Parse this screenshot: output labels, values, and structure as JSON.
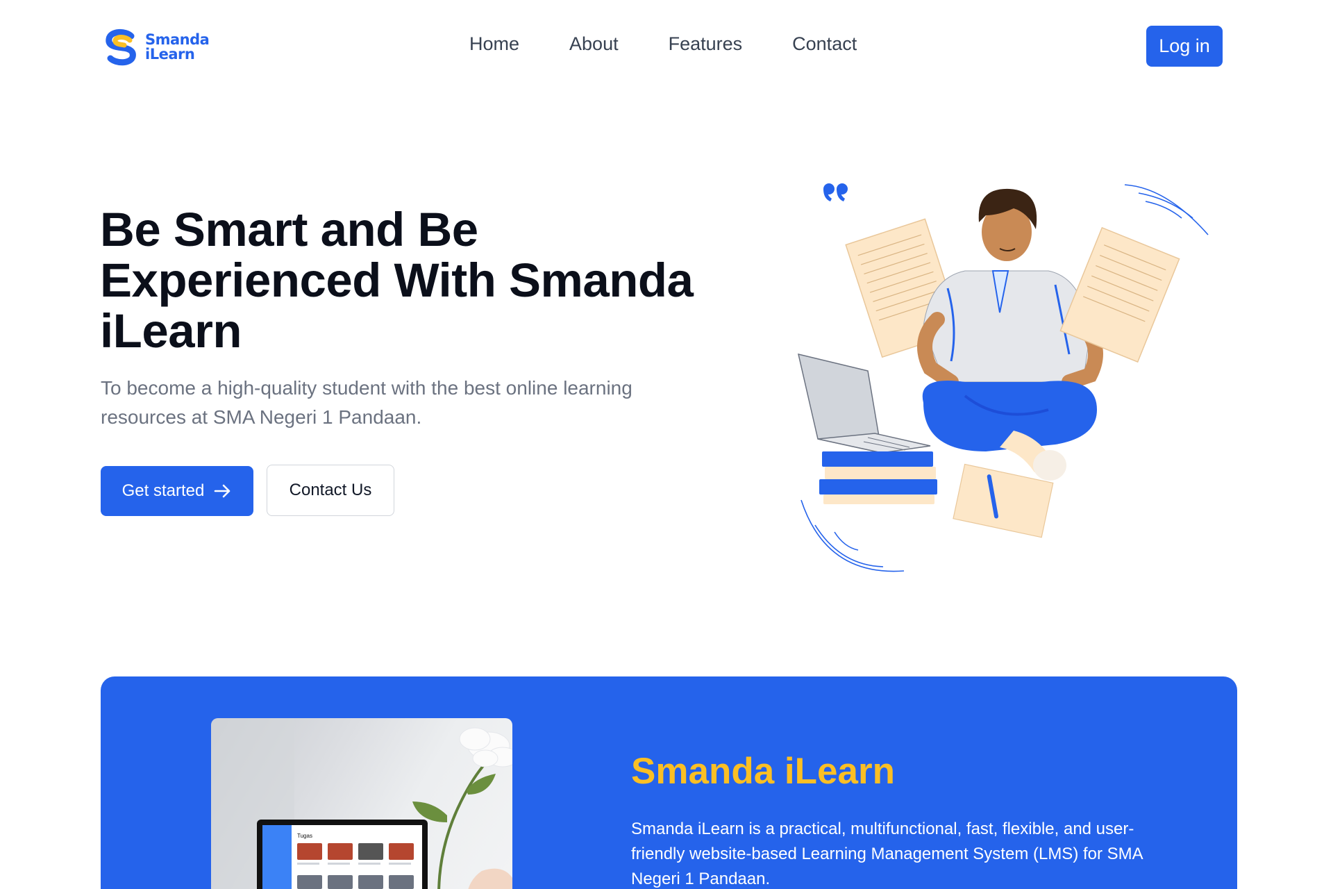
{
  "brand": {
    "name_line1": "Smanda",
    "name_line2": "iLearn",
    "primary_color": "#2563eb",
    "accent_color": "#fbbf24"
  },
  "nav": {
    "links": [
      "Home",
      "About",
      "Features",
      "Contact"
    ],
    "login_label": "Log in"
  },
  "hero": {
    "title": "Be Smart and Be Experienced With Smanda iLearn",
    "subtitle": "To become a high-quality student with the best online learning resources at SMA Negeri 1 Pandaan.",
    "primary_cta": "Get started",
    "secondary_cta": "Contact Us",
    "illustration_icon": "student-reading-illustration"
  },
  "feature": {
    "title": "Smanda iLearn",
    "description": "Smanda iLearn is a practical, multifunctional, fast, flexible, and user-friendly website-based Learning Management System (LMS) for SMA Negeri 1 Pandaan.",
    "photo_icon": "laptop-with-flower-photo",
    "screen_heading": "Tugas"
  }
}
